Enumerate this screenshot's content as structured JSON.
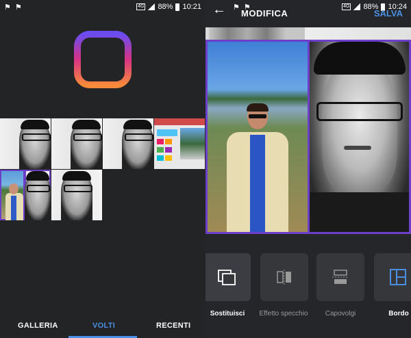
{
  "left_screen": {
    "status": {
      "battery": "88%",
      "time": "10:21",
      "network": "4G"
    },
    "tabs": [
      {
        "label": "GALLERIA"
      },
      {
        "label": "VOLTI"
      },
      {
        "label": "RECENTI"
      }
    ]
  },
  "right_screen": {
    "status": {
      "battery": "88%",
      "time": "10:24",
      "network": "4G"
    },
    "header": {
      "back": "←",
      "title": "MODIFICA",
      "save": "SALVA"
    },
    "tools": [
      {
        "label": "Sostituisci"
      },
      {
        "label": "Effetto specchio"
      },
      {
        "label": "Capovolgi"
      },
      {
        "label": "Bordo"
      }
    ]
  },
  "colors": {
    "accent": "#4a90e2",
    "selection": "#6b3fc8",
    "background": "#232426",
    "logo_gradient": [
      "#6a4cf0",
      "#d63384",
      "#f7893b"
    ]
  }
}
